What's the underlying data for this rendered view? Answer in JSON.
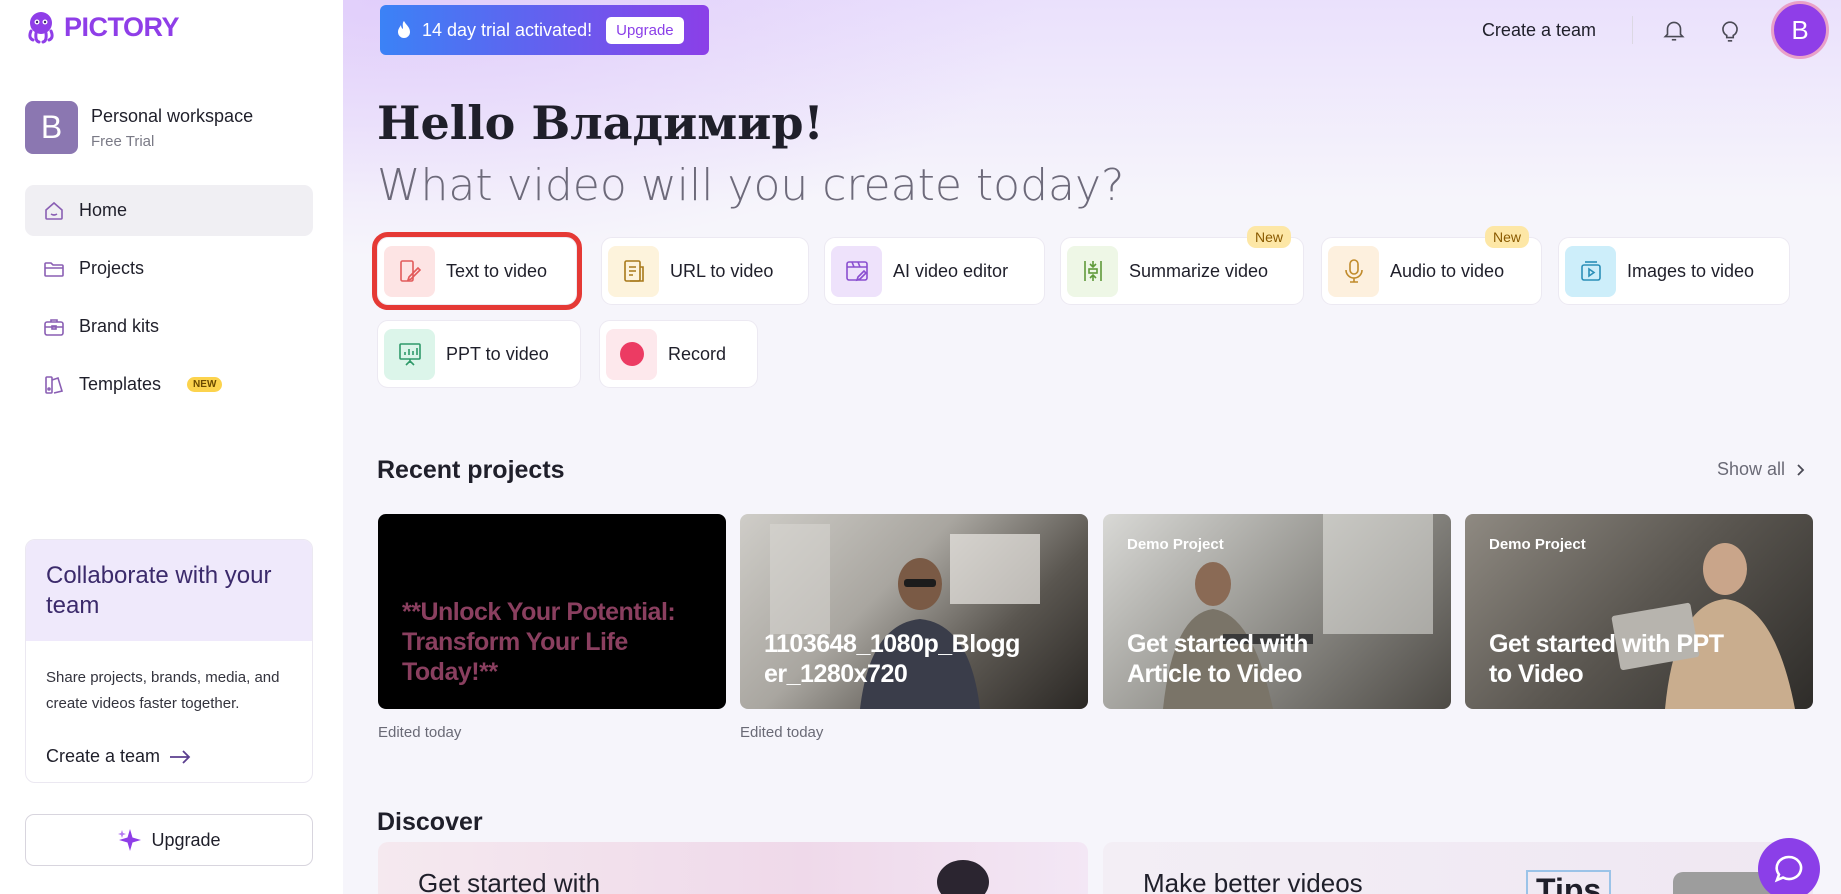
{
  "brand": {
    "name": "PICTORY",
    "color": "#8f3ee8"
  },
  "workspace": {
    "avatar_letter": "B",
    "name": "Personal workspace",
    "plan": "Free Trial"
  },
  "nav": {
    "items": [
      {
        "label": "Home",
        "icon": "home-icon",
        "active": true
      },
      {
        "label": "Projects",
        "icon": "folder-icon"
      },
      {
        "label": "Brand kits",
        "icon": "briefcase-icon"
      },
      {
        "label": "Templates",
        "icon": "templates-icon",
        "badge": "NEW"
      }
    ]
  },
  "collab": {
    "title": "Collaborate with your team",
    "body": "Share projects, brands, media, and create videos faster together.",
    "link": "Create a team"
  },
  "sidebar_upgrade": "Upgrade",
  "trial": {
    "text": "14 day trial activated!",
    "button": "Upgrade"
  },
  "header": {
    "create_team": "Create a team",
    "avatar_letter": "B"
  },
  "greeting": "Hello Владимир!",
  "subtitle": "What video will you create today?",
  "actions": [
    {
      "label": "Text to video",
      "icon": "text-to-video-icon",
      "highlighted": true
    },
    {
      "label": "URL to video",
      "icon": "url-icon"
    },
    {
      "label": "AI video editor",
      "icon": "video-editor-icon"
    },
    {
      "label": "Summarize video",
      "icon": "summarize-icon",
      "tag": "New"
    },
    {
      "label": "Audio to video",
      "icon": "microphone-icon",
      "tag": "New"
    },
    {
      "label": "Images to video",
      "icon": "images-icon"
    },
    {
      "label": "PPT to video",
      "icon": "presentation-icon"
    },
    {
      "label": "Record",
      "icon": "record-icon"
    }
  ],
  "recent": {
    "title": "Recent projects",
    "show_all": "Show all",
    "cards": [
      {
        "title": "**Unlock Your Potential: Transform Your Life Today!**",
        "meta": "Edited today"
      },
      {
        "title": "1103648_1080p_Blogger_1280x720",
        "meta": "Edited today"
      },
      {
        "demo": "Demo Project",
        "title": "Get started with Article to Video"
      },
      {
        "demo": "Demo Project",
        "title": "Get started with PPT to Video"
      }
    ]
  },
  "discover": {
    "title": "Discover",
    "cards": [
      {
        "text": "Get started with"
      },
      {
        "text": "Make better videos",
        "extra": "Tips"
      }
    ]
  }
}
